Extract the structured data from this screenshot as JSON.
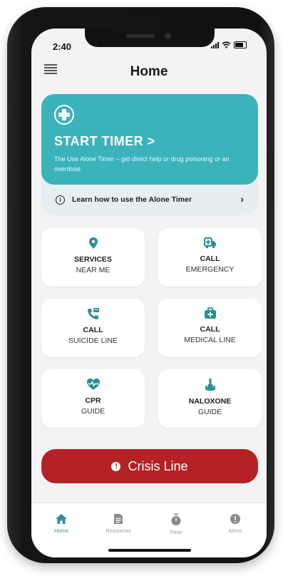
{
  "status_bar": {
    "time": "2:40"
  },
  "header": {
    "title": "Home"
  },
  "timer_card": {
    "title": "START TIMER >",
    "description": "The Use Alone Timer – get direct help or drug poisoning or an overdose.",
    "learn_link": "Learn how to use the Alone Timer"
  },
  "tiles": [
    {
      "line1": "SERVICES",
      "line2": "NEAR ME",
      "icon": "location-pin-icon"
    },
    {
      "line1": "CALL",
      "line2": "EMERGENCY",
      "icon": "ambulance-icon"
    },
    {
      "line1": "CALL",
      "line2": "SUICIDE LINE",
      "icon": "phone-chat-icon"
    },
    {
      "line1": "CALL",
      "line2": "MEDICAL LINE",
      "icon": "medical-kit-icon"
    },
    {
      "line1": "CPR",
      "line2": "GUIDE",
      "icon": "heart-pulse-icon"
    },
    {
      "line1": "NALOXONE",
      "line2": "GUIDE",
      "icon": "naloxone-icon"
    }
  ],
  "crisis_button": {
    "label": "Crisis Line"
  },
  "tabbar": {
    "items": [
      {
        "label": "Home",
        "icon": "home-icon",
        "active": true
      },
      {
        "label": "Resources",
        "icon": "document-icon",
        "active": false
      },
      {
        "label": "Timer",
        "icon": "stopwatch-icon",
        "active": false
      },
      {
        "label": "Alerts",
        "icon": "alert-icon",
        "active": false
      }
    ]
  },
  "colors": {
    "accent": "#3cb2bb",
    "icon_teal": "#2c8f98",
    "crisis_red": "#b42126",
    "background": "#f3f3f3"
  }
}
